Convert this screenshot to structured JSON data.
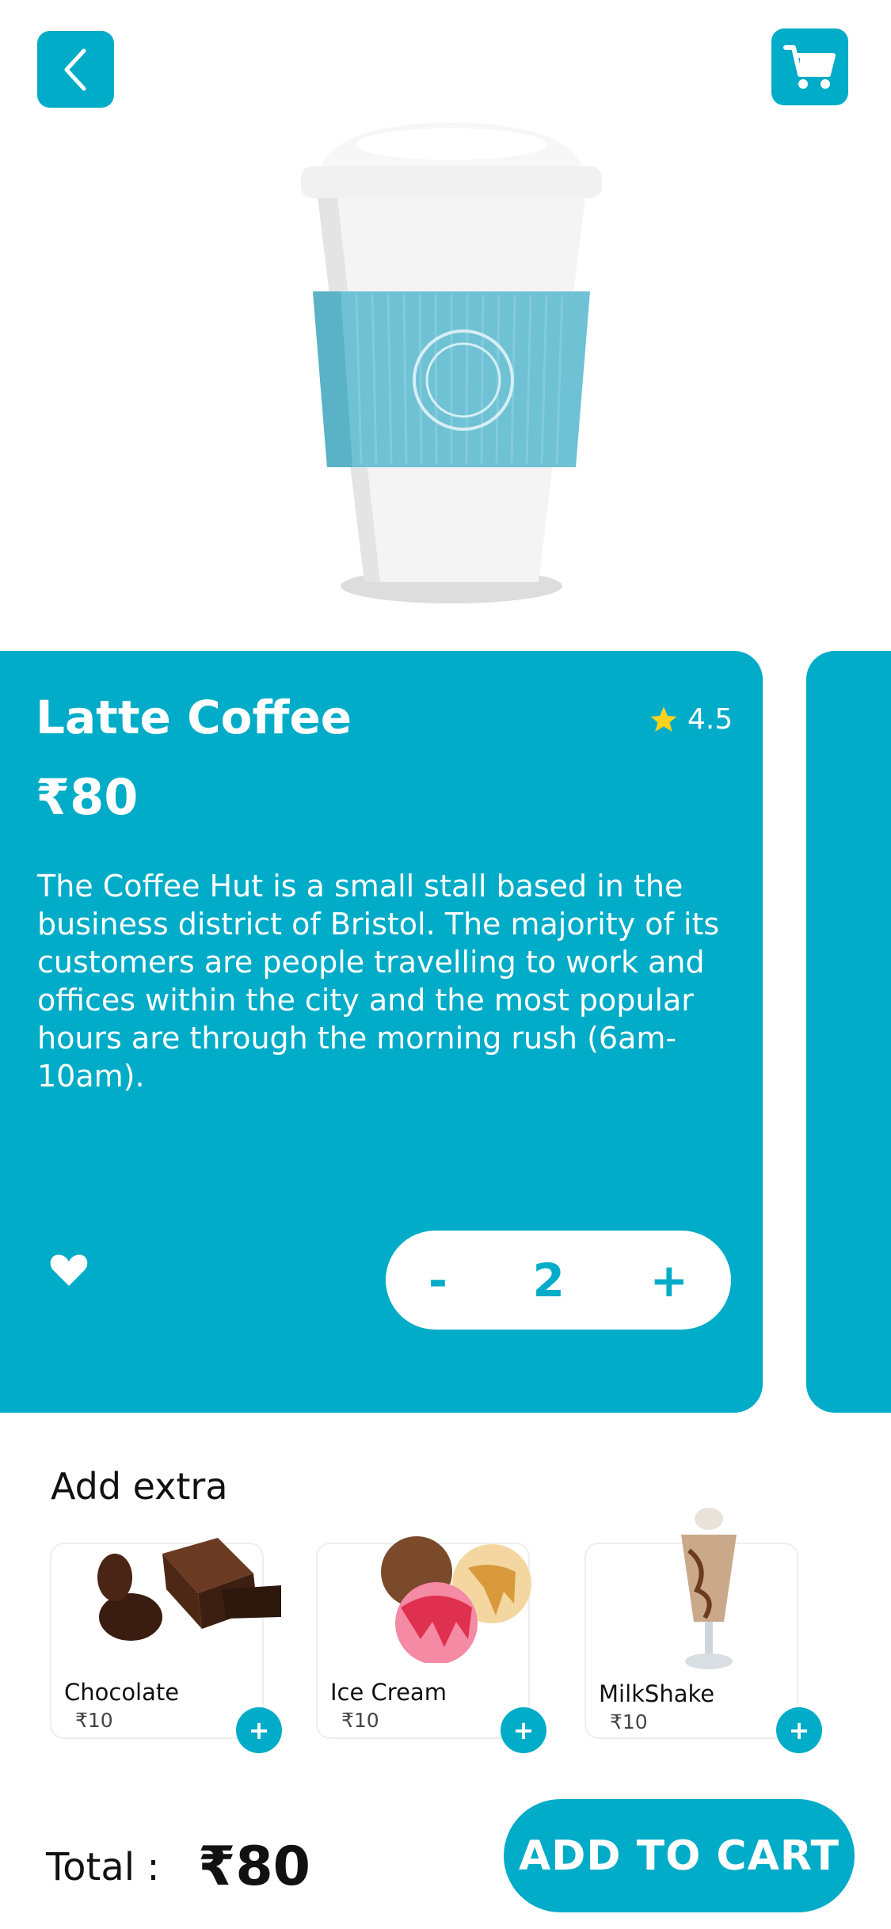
{
  "product": {
    "name": "Latte Coffee",
    "rating": "4.5",
    "price": "₹80",
    "description": "The Coffee Hut is a small stall based in the business district of Bristol. The majority of its customers are people travelling to work and offices within the city and the most popular hours are through the morning rush (6am-10am).",
    "quantity": "2",
    "minus": "-",
    "plus": "+"
  },
  "extras": {
    "title": "Add extra",
    "items": [
      {
        "name": "Chocolate",
        "price": "₹10",
        "add": "+"
      },
      {
        "name": "Ice Cream",
        "price": "₹10",
        "add": "+"
      },
      {
        "name": "MilkShake",
        "price": "₹10",
        "add": "+"
      }
    ]
  },
  "footer": {
    "total_label": "Total :",
    "total_value": "₹80",
    "cta": "ADD TO CART"
  },
  "colors": {
    "accent": "#00acc8",
    "star": "#ffd21f",
    "text_dark": "#111111"
  },
  "icons": [
    "back-arrow-icon",
    "cart-icon",
    "star-icon",
    "heart-icon",
    "plus-icon"
  ]
}
